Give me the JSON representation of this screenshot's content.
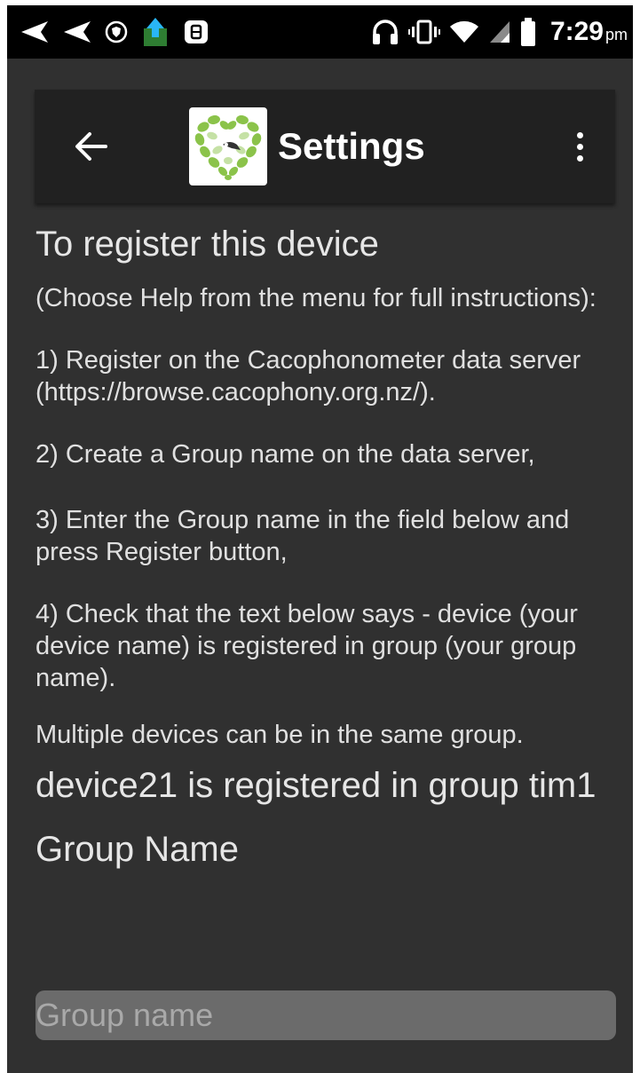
{
  "status_bar": {
    "icons_left": [
      "send-icon",
      "send-icon",
      "vpn-shield-icon",
      "upload-app-icon",
      "app-notification-icon"
    ],
    "icons_right": [
      "headphones-icon",
      "vibrate-icon",
      "wifi-icon",
      "cell-signal-icon",
      "battery-icon"
    ],
    "time": "7:29",
    "ampm": "pm"
  },
  "toolbar": {
    "title": "Settings",
    "back_icon": "arrow-left-icon",
    "overflow_icon": "more-vert-icon",
    "logo_icon": "leaf-heart-bird-logo"
  },
  "content": {
    "heading": "To register this device",
    "intro": "(Choose Help from the menu for full instructions):",
    "step1": "1) Register on the Cacophonometer data server (https://browse.cacophony.org.nz/).",
    "step2": "2) Create a Group name on the data server,",
    "step3": "3) Enter the Group name in the field below and press Register button,",
    "step4": "4) Check that the text below says - device (your device name) is registered in group (your group name).",
    "note": "Multiple devices can be in the same group.",
    "registration_status": "device21 is registered in group tim1",
    "group_label": "Group Name",
    "group_input_value": "",
    "group_input_placeholder": "Group name"
  },
  "colors": {
    "background": "#303030",
    "toolbar": "#212121",
    "status_bar": "#000000",
    "input_bg": "#6b6b6b"
  }
}
